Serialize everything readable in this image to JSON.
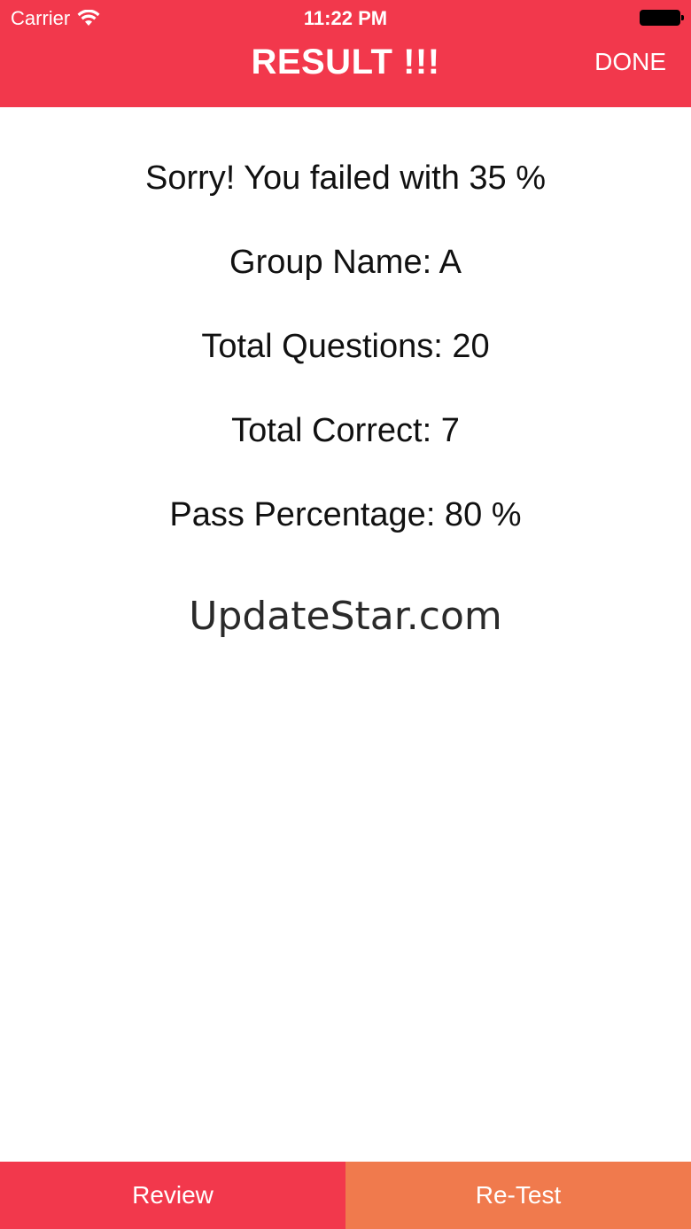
{
  "status_bar": {
    "carrier": "Carrier",
    "time": "11:22 PM",
    "wifi_icon": "wifi-icon",
    "battery_icon": "battery-icon"
  },
  "header": {
    "title": "RESULT !!!",
    "done_label": "DONE",
    "color": "#f2384c"
  },
  "result": {
    "message": "Sorry! You failed with 35 %",
    "group_name": "Group Name: A",
    "total_questions": "Total Questions: 20",
    "total_correct": "Total Correct: 7",
    "pass_percentage": "Pass Percentage: 80 %"
  },
  "watermark": "UpdateStar.com",
  "bottom": {
    "review_label": "Review",
    "retest_label": "Re-Test",
    "review_color": "#f2384c",
    "retest_color": "#f07a4d"
  }
}
